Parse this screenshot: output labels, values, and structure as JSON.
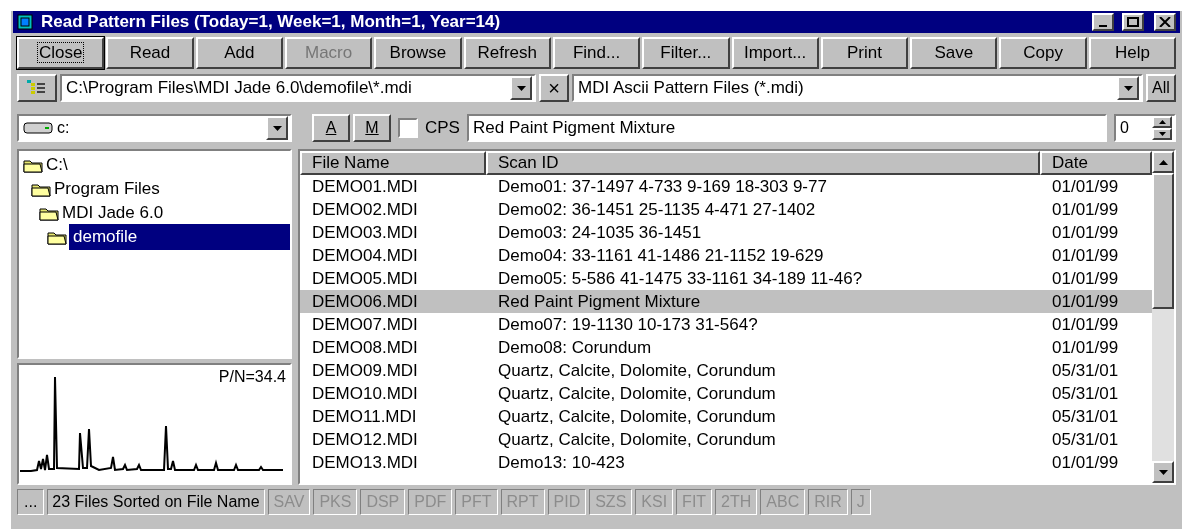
{
  "window": {
    "title": "Read Pattern Files (Today=1, Week=1, Month=1, Year=14)"
  },
  "toolbar": [
    {
      "label": "Close",
      "disabled": false,
      "focused": true
    },
    {
      "label": "Read",
      "disabled": false,
      "focused": false
    },
    {
      "label": "Add",
      "disabled": false,
      "focused": false
    },
    {
      "label": "Macro",
      "disabled": true,
      "focused": false
    },
    {
      "label": "Browse",
      "disabled": false,
      "focused": false
    },
    {
      "label": "Refresh",
      "disabled": false,
      "focused": false
    },
    {
      "label": "Find...",
      "disabled": false,
      "focused": false
    },
    {
      "label": "Filter...",
      "disabled": false,
      "focused": false
    },
    {
      "label": "Import...",
      "disabled": false,
      "focused": false
    },
    {
      "label": "Print",
      "disabled": false,
      "focused": false
    },
    {
      "label": "Save",
      "disabled": false,
      "focused": false
    },
    {
      "label": "Copy",
      "disabled": false,
      "focused": false
    },
    {
      "label": "Help",
      "disabled": false,
      "focused": false
    }
  ],
  "path_field": {
    "value": "C:\\Program Files\\MDI Jade 6.0\\demofile\\*.mdi"
  },
  "clear_button": {
    "label": "×"
  },
  "file_type_field": {
    "value": "MDI Ascii Pattern Files (*.mdi)"
  },
  "all_button": {
    "label": "All"
  },
  "drive_field": {
    "value": "c:"
  },
  "a_button": {
    "label": "A"
  },
  "m_button": {
    "label": "M"
  },
  "cps": {
    "label": "CPS",
    "checked": false
  },
  "scan_id_field": {
    "value": "Red Paint Pigment Mixture"
  },
  "number_field": {
    "value": "0"
  },
  "folder_tree": [
    {
      "label": "C:\\",
      "selected": false,
      "children": [
        {
          "label": "Program Files",
          "selected": false,
          "children": [
            {
              "label": "MDI Jade 6.0",
              "selected": false,
              "children": [
                {
                  "label": "demofile",
                  "selected": true
                }
              ]
            }
          ]
        }
      ]
    }
  ],
  "preview": {
    "reading": "P/N=34.4"
  },
  "table": {
    "columns": [
      "File Name",
      "Scan ID",
      "Date"
    ],
    "rows": [
      {
        "cells": [
          "DEMO01.MDI",
          "Demo01: 37-1497 4-733 9-169 18-303 9-77",
          "01/01/99"
        ],
        "selected": false
      },
      {
        "cells": [
          "DEMO02.MDI",
          "Demo02: 36-1451 25-1135 4-471 27-1402",
          "01/01/99"
        ],
        "selected": false
      },
      {
        "cells": [
          "DEMO03.MDI",
          "Demo03: 24-1035 36-1451",
          "01/01/99"
        ],
        "selected": false
      },
      {
        "cells": [
          "DEMO04.MDI",
          "Demo04: 33-1161 41-1486 21-1152 19-629",
          "01/01/99"
        ],
        "selected": false
      },
      {
        "cells": [
          "DEMO05.MDI",
          "Demo05: 5-586 41-1475 33-1161 34-189 11-46?",
          "01/01/99"
        ],
        "selected": false
      },
      {
        "cells": [
          "DEMO06.MDI",
          "Red Paint Pigment Mixture",
          "01/01/99"
        ],
        "selected": true
      },
      {
        "cells": [
          "DEMO07.MDI",
          "Demo07: 19-1130 10-173 31-564?",
          "01/01/99"
        ],
        "selected": false
      },
      {
        "cells": [
          "DEMO08.MDI",
          "Demo08: Corundum",
          "01/01/99"
        ],
        "selected": false
      },
      {
        "cells": [
          "DEMO09.MDI",
          "Quartz, Calcite, Dolomite, Corundum",
          "05/31/01"
        ],
        "selected": false
      },
      {
        "cells": [
          "DEMO10.MDI",
          "Quartz, Calcite, Dolomite, Corundum",
          "05/31/01"
        ],
        "selected": false
      },
      {
        "cells": [
          "DEMO11.MDI",
          "Quartz, Calcite, Dolomite, Corundum",
          "05/31/01"
        ],
        "selected": false
      },
      {
        "cells": [
          "DEMO12.MDI",
          "Quartz, Calcite, Dolomite, Corundum",
          "05/31/01"
        ],
        "selected": false
      },
      {
        "cells": [
          "DEMO13.MDI",
          "Demo13: 10-423",
          "01/01/99"
        ],
        "selected": false
      }
    ]
  },
  "status_bar": {
    "menu_button": "...",
    "message": "23 Files Sorted on File Name",
    "indicators": [
      {
        "label": "SAV",
        "disabled": true
      },
      {
        "label": "PKS",
        "disabled": true
      },
      {
        "label": "DSP",
        "disabled": true
      },
      {
        "label": "PDF",
        "disabled": true
      },
      {
        "label": "PFT",
        "disabled": true
      },
      {
        "label": "RPT",
        "disabled": true
      },
      {
        "label": "PID",
        "disabled": true
      },
      {
        "label": "SZS",
        "disabled": true
      },
      {
        "label": "KSI",
        "disabled": true
      },
      {
        "label": "FIT",
        "disabled": true
      },
      {
        "label": "2TH",
        "disabled": true
      },
      {
        "label": "ABC",
        "disabled": true
      },
      {
        "label": "RIR",
        "disabled": true
      },
      {
        "label": "J",
        "disabled": true
      }
    ]
  }
}
